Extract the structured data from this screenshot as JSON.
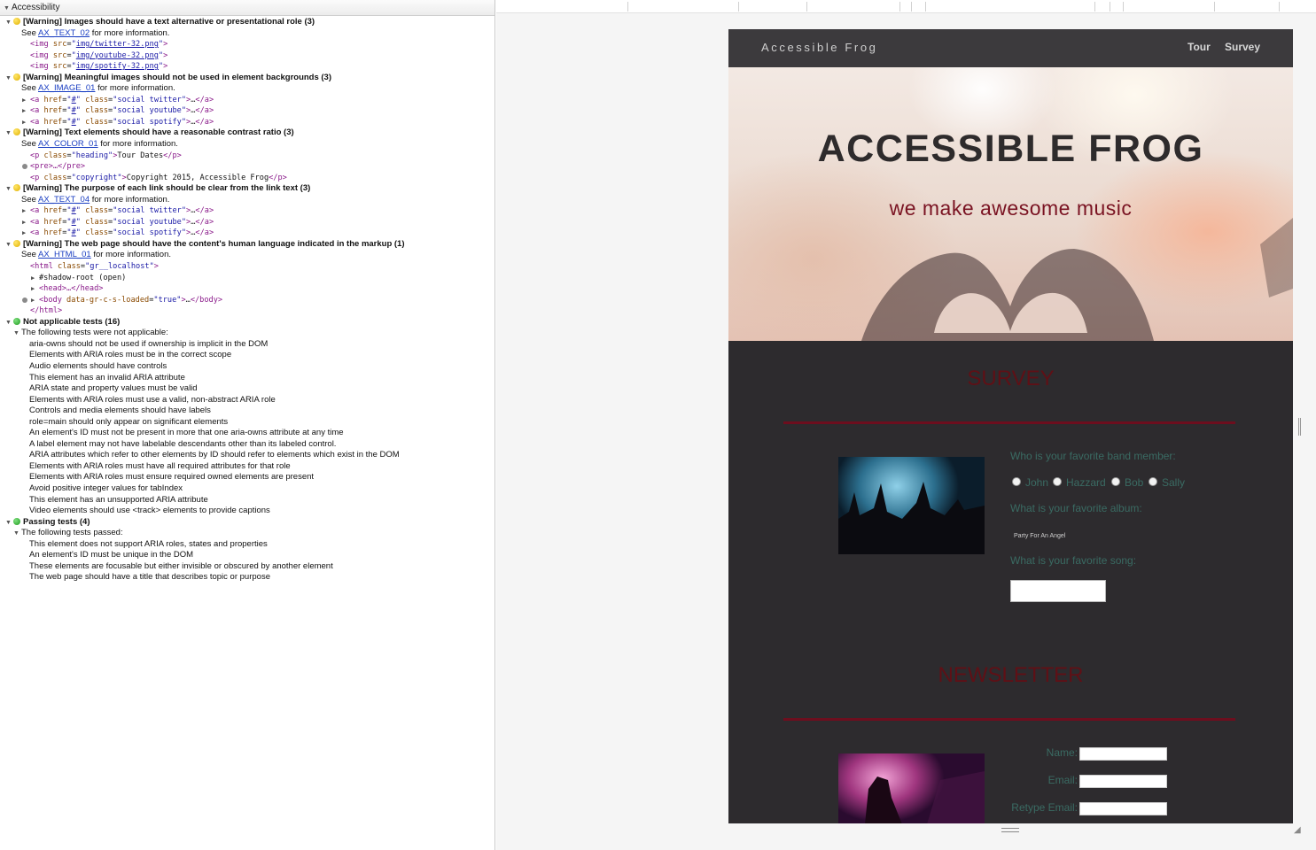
{
  "panel": {
    "title": "Accessibility"
  },
  "tree": {
    "w1": {
      "title": "[Warning] Images should have a text alternative or presentational role (3)",
      "see_pre": "See ",
      "link": "AX_TEXT_02",
      "see_post": " for more information.",
      "code": [
        "img/twitter-32.png",
        "img/youtube-32.png",
        "img/spotify-32.png"
      ]
    },
    "w2": {
      "title": "[Warning] Meaningful images should not be used in element backgrounds (3)",
      "see_pre": "See ",
      "link": "AX_IMAGE_01",
      "see_post": " for more information.",
      "classes": [
        "social twitter",
        "social youtube",
        "social spotify"
      ]
    },
    "w3": {
      "title": "[Warning] Text elements should have a reasonable contrast ratio (3)",
      "see_pre": "See ",
      "link": "AX_COLOR_01",
      "see_post": " for more information.",
      "p1_class": "heading",
      "p1_text": "Tour Dates",
      "pre": "<pre>…</pre>",
      "p3_class": "copyright",
      "p3_text": "Copyright 2015, Accessible Frog"
    },
    "w4": {
      "title": "[Warning] The purpose of each link should be clear from the link text (3)",
      "see_pre": "See ",
      "link": "AX_TEXT_04",
      "see_post": " for more information.",
      "classes": [
        "social twitter",
        "social youtube",
        "social spotify"
      ]
    },
    "w5": {
      "title": "[Warning] The web page should have the content's human language indicated in the markup (1)",
      "see_pre": "See ",
      "link": "AX_HTML_01",
      "see_post": " for more information.",
      "html_class": "gr__localhost",
      "shadow": "#shadow-root (open)",
      "head": "<head>…</head>",
      "body_attr": "data-gr-c-s-loaded",
      "body_val": "true",
      "close": "</html>"
    },
    "na": {
      "title": "Not applicable tests (16)",
      "sub": "The following tests were not applicable:",
      "items": [
        "aria-owns should not be used if ownership is implicit in the DOM",
        "Elements with ARIA roles must be in the correct scope",
        "Audio elements should have controls",
        "This element has an invalid ARIA attribute",
        "ARIA state and property values must be valid",
        "Elements with ARIA roles must use a valid, non-abstract ARIA role",
        "Controls and media elements should have labels",
        "role=main should only appear on significant elements",
        "An element's ID must not be present in more that one aria-owns attribute at any time",
        "A label element may not have labelable descendants other than its labeled control.",
        "ARIA attributes which refer to other elements by ID should refer to elements which exist in the DOM",
        "Elements with ARIA roles must have all required attributes for that role",
        "Elements with ARIA roles must ensure required owned elements are present",
        "Avoid positive integer values for tabIndex",
        "This element has an unsupported ARIA attribute",
        "Video elements should use <track> elements to provide captions"
      ]
    },
    "pass": {
      "title": "Passing tests (4)",
      "sub": "The following tests passed:",
      "items": [
        "This element does not support ARIA roles, states and properties",
        "An element's ID must be unique in the DOM",
        "These elements are focusable but either invisible or obscured by another element",
        "The web page should have a title that describes topic or purpose"
      ]
    }
  },
  "site": {
    "brand": "Accessible Frog",
    "nav": {
      "tour": "Tour",
      "survey": "Survey"
    },
    "hero": {
      "title": "ACCESSIBLE FROG",
      "subtitle": "we make awesome music"
    },
    "survey": {
      "title": "SURVEY",
      "q1": "Who is your favorite band member:",
      "members": [
        "John",
        "Hazzard",
        "Bob",
        "Sally"
      ],
      "q2": "What is your favorite album:",
      "album": "Party For An Angel",
      "q3": "What is your favorite song:"
    },
    "newsletter": {
      "title": "NEWSLETTER",
      "name_label": "Name:",
      "email_label": "Email:",
      "retype_label": "Retype Email:"
    }
  },
  "colors": {
    "accent": "#6d0e1e",
    "page_bg": "#2d2b2e",
    "label_teal": "#3a6b63",
    "warning": "#e0b000",
    "pass": "#1f9a1f"
  }
}
